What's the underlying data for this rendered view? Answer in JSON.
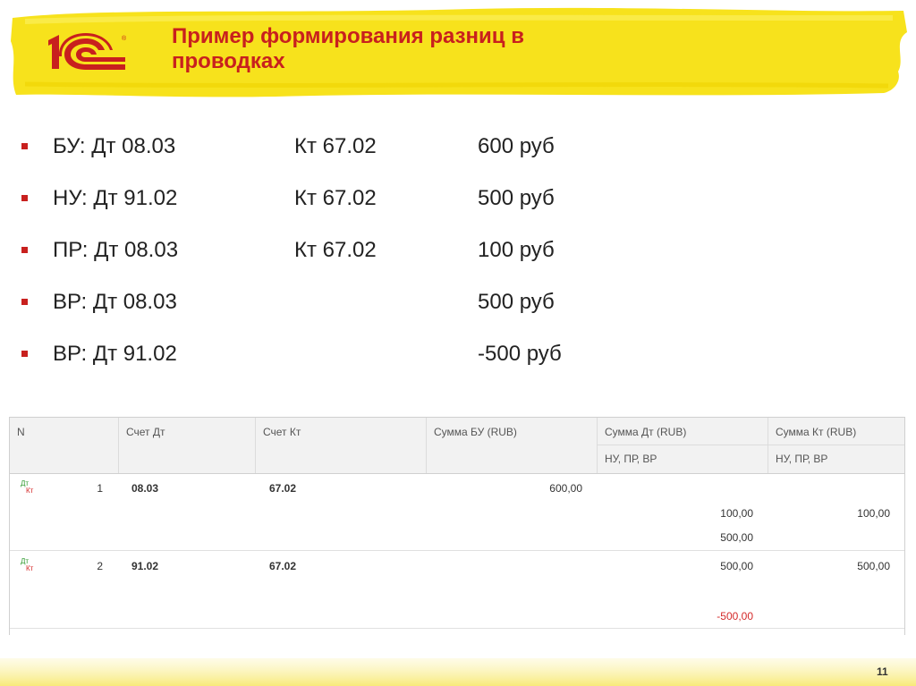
{
  "slide": {
    "title_line1": "Пример формирования разниц в",
    "title_line2": "проводках",
    "page_number": "11"
  },
  "brand": {
    "logo_text": "1С",
    "registered": "®",
    "accent": "#c8201e",
    "yellow": "#f7e21c"
  },
  "bullets": [
    {
      "label": "БУ: Дт 08.03",
      "credit": "Кт 67.02",
      "amount": "600 руб"
    },
    {
      "label": "НУ: Дт 91.02",
      "credit": "Кт 67.02",
      "amount": "500 руб"
    },
    {
      "label": "ПР: Дт 08.03",
      "credit": "Кт 67.02",
      "amount": "100 руб"
    },
    {
      "label": "ВР: Дт 08.03",
      "credit": "",
      "amount": "500 руб"
    },
    {
      "label": "ВР: Дт 91.02",
      "credit": "",
      "amount": "-500 руб"
    }
  ],
  "table": {
    "headers": {
      "n": "N",
      "debit": "Счет Дт",
      "credit": "Счет Кт",
      "sum_bu": "Сумма БУ (RUB)",
      "sum_dt": "Сумма Дт (RUB)",
      "sum_dt_sub": "НУ, ПР, ВР",
      "sum_kt": "Сумма Кт (RUB)",
      "sum_kt_sub": "НУ, ПР, ВР"
    },
    "dt_mark": "Дт",
    "kt_mark": "Кт",
    "rows": [
      {
        "n": "1",
        "debit": "08.03",
        "credit": "67.02",
        "sum_bu": "600,00",
        "sum_dt_1": "100,00",
        "sum_dt_2": "500,00",
        "sum_kt_1": "100,00"
      },
      {
        "n": "2",
        "debit": "91.02",
        "credit": "67.02",
        "sum_bu": "",
        "sum_dt_1": "500,00",
        "sum_dt_2": "-500,00",
        "sum_kt_1": "500,00"
      }
    ]
  }
}
